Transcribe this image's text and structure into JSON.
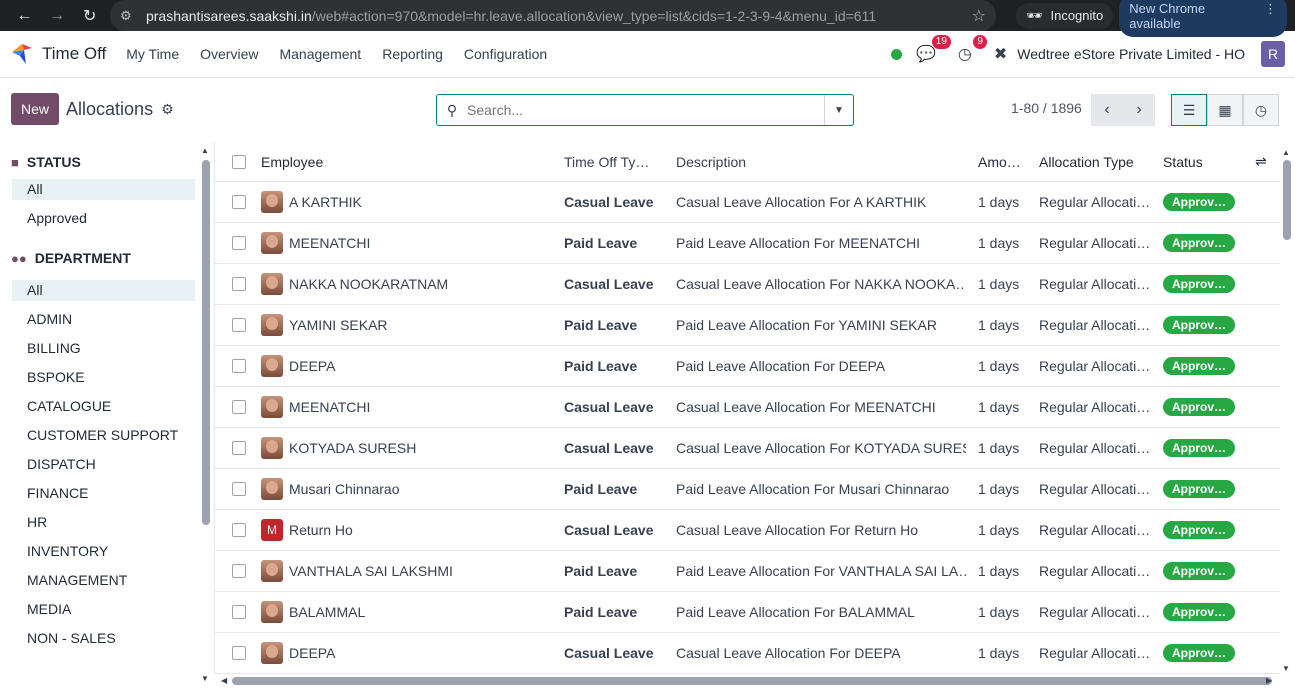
{
  "browser": {
    "url_main": "prashantisarees.saakshi.in",
    "url_rest": "/web#action=970&model=hr.leave.allocation&view_type=list&cids=1-2-3-9-4&menu_id=611",
    "incognito_label": "Incognito",
    "update_label": "New Chrome available"
  },
  "navbar": {
    "app_name": "Time Off",
    "menus": [
      "My Time",
      "Overview",
      "Management",
      "Reporting",
      "Configuration"
    ],
    "chat_count": "19",
    "activity_count": "9",
    "company": "Wedtree eStore Private Limited - HO",
    "user_initial": "R"
  },
  "control_panel": {
    "new_label": "New",
    "title": "Allocations",
    "search_placeholder": "Search...",
    "pager": "1-80 / 1896"
  },
  "sidebar": {
    "status_title": "STATUS",
    "status_items": [
      "All",
      "Approved"
    ],
    "department_title": "DEPARTMENT",
    "department_items": [
      "All",
      "ADMIN",
      "BILLING",
      "BSPOKE",
      "CATALOGUE",
      "CUSTOMER SUPPORT",
      "DISPATCH",
      "FINANCE",
      "HR",
      "INVENTORY",
      "MANAGEMENT",
      "MEDIA",
      "NON - SALES"
    ]
  },
  "table": {
    "headers": {
      "employee": "Employee",
      "type": "Time Off Ty…",
      "description": "Description",
      "amount": "Amo…",
      "alloc_type": "Allocation Type",
      "status": "Status"
    },
    "rows": [
      {
        "employee": "A KARTHIK",
        "type": "Casual Leave",
        "description": "Casual Leave Allocation For A KARTHIK",
        "amount": "1 days",
        "alloc_type": "Regular Allocati…",
        "status": "Approv…"
      },
      {
        "employee": "MEENATCHI",
        "type": "Paid Leave",
        "description": "Paid Leave Allocation For MEENATCHI",
        "amount": "1 days",
        "alloc_type": "Regular Allocati…",
        "status": "Approv…"
      },
      {
        "employee": "NAKKA NOOKARATNAM",
        "type": "Casual Leave",
        "description": "Casual Leave Allocation For NAKKA NOOKA…",
        "amount": "1 days",
        "alloc_type": "Regular Allocati…",
        "status": "Approv…"
      },
      {
        "employee": "YAMINI SEKAR",
        "type": "Paid Leave",
        "description": "Paid Leave Allocation For YAMINI SEKAR",
        "amount": "1 days",
        "alloc_type": "Regular Allocati…",
        "status": "Approv…"
      },
      {
        "employee": "DEEPA",
        "type": "Paid Leave",
        "description": "Paid Leave Allocation For DEEPA",
        "amount": "1 days",
        "alloc_type": "Regular Allocati…",
        "status": "Approv…"
      },
      {
        "employee": "MEENATCHI",
        "type": "Casual Leave",
        "description": "Casual Leave Allocation For MEENATCHI",
        "amount": "1 days",
        "alloc_type": "Regular Allocati…",
        "status": "Approv…"
      },
      {
        "employee": "KOTYADA SURESH",
        "type": "Casual Leave",
        "description": "Casual Leave Allocation For KOTYADA SURESH",
        "amount": "1 days",
        "alloc_type": "Regular Allocati…",
        "status": "Approv…"
      },
      {
        "employee": "Musari Chinnarao",
        "type": "Paid Leave",
        "description": "Paid Leave Allocation For Musari Chinnarao",
        "amount": "1 days",
        "alloc_type": "Regular Allocati…",
        "status": "Approv…"
      },
      {
        "employee": "Return Ho",
        "type": "Casual Leave",
        "description": "Casual Leave Allocation For Return Ho",
        "amount": "1 days",
        "alloc_type": "Regular Allocati…",
        "status": "Approv…",
        "initial": "M"
      },
      {
        "employee": "VANTHALA SAI LAKSHMI",
        "type": "Paid Leave",
        "description": "Paid Leave Allocation For VANTHALA SAI LA…",
        "amount": "1 days",
        "alloc_type": "Regular Allocati…",
        "status": "Approv…"
      },
      {
        "employee": "BALAMMAL",
        "type": "Paid Leave",
        "description": "Paid Leave Allocation For BALAMMAL",
        "amount": "1 days",
        "alloc_type": "Regular Allocati…",
        "status": "Approv…"
      },
      {
        "employee": "DEEPA",
        "type": "Casual Leave",
        "description": "Casual Leave Allocation For DEEPA",
        "amount": "1 days",
        "alloc_type": "Regular Allocati…",
        "status": "Approv…"
      }
    ]
  },
  "colors": {
    "brand": "#714b67",
    "accent": "#017e84",
    "approved": "#28a745",
    "badge": "#e11d48"
  }
}
